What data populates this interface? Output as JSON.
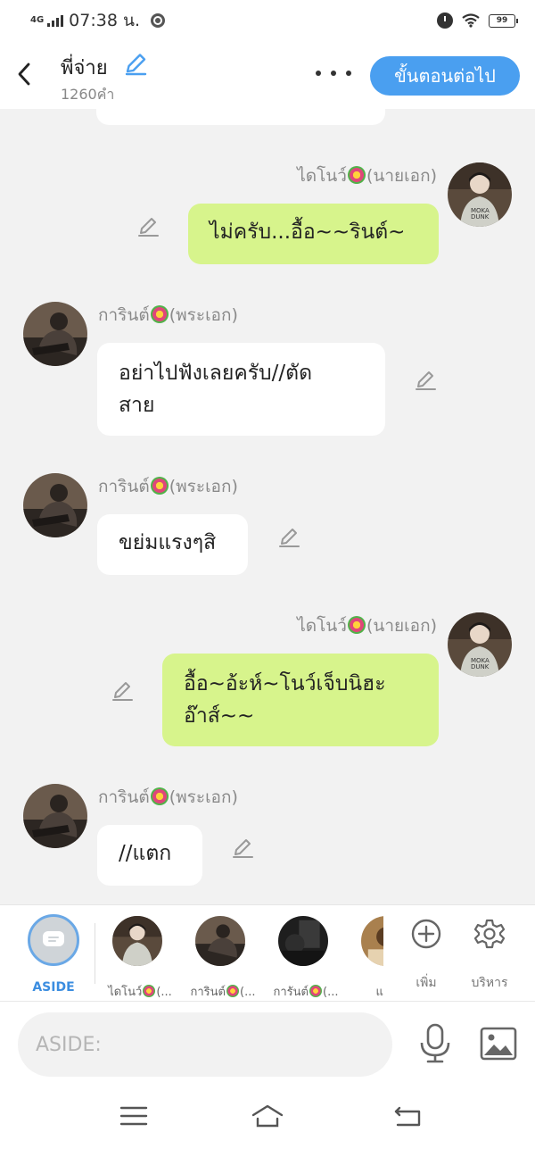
{
  "status_bar": {
    "network": "4G",
    "time": "07:38 น.",
    "battery": "99"
  },
  "header": {
    "title": "พี่จ่าย",
    "word_count": "1260คำ",
    "next_button": "ขั้นตอนต่อไป"
  },
  "messages": [
    {
      "side": "right",
      "sender": "ไดโนว์",
      "role": "(นายเอก)",
      "text": "ไม่ครับ...อื้อ~~รินต์~"
    },
    {
      "side": "left",
      "sender": "การินต์",
      "role": "(พระเอก)",
      "text_lines": [
        "อย่าไปฟังเลยครับ//ตัด",
        "สาย"
      ]
    },
    {
      "side": "left",
      "sender": "การินต์",
      "role": "(พระเอก)",
      "text": "ขย่มแรงๆสิ"
    },
    {
      "side": "right",
      "sender": "ไดโนว์",
      "role": "(นายเอก)",
      "text_lines": [
        "อื้อ~อ้ะห์~โนว์เจ็บนิฮะ",
        "อ๊าส์~~"
      ]
    },
    {
      "side": "left",
      "sender": "การินต์",
      "role": "(พระเอก)",
      "text": "//แตก"
    }
  ],
  "bottom_bar": {
    "aside_label": "ASIDE",
    "characters": [
      {
        "name": "ไดโนว์",
        "suffix": "(..."
      },
      {
        "name": "การินต์",
        "suffix": "(..."
      },
      {
        "name": "การันต์",
        "suffix": "(..."
      },
      {
        "name": "แอดเ",
        "suffix": ""
      }
    ],
    "add_label": "เพิ่ม",
    "manage_label": "บริหาร"
  },
  "input": {
    "placeholder": "ASIDE:"
  },
  "colors": {
    "accent": "#4a9ff0",
    "right_bubble": "#d7f48c",
    "left_bubble": "#ffffff",
    "chat_background": "#f2f2f2"
  },
  "icons": {
    "back": "chevron-left-icon",
    "title_edit": "pencil-icon",
    "more": "more-dots-icon",
    "message_edit": "pencil-icon",
    "add": "plus-circle-icon",
    "manage": "gear-icon",
    "mic": "microphone-icon",
    "image": "image-icon"
  }
}
